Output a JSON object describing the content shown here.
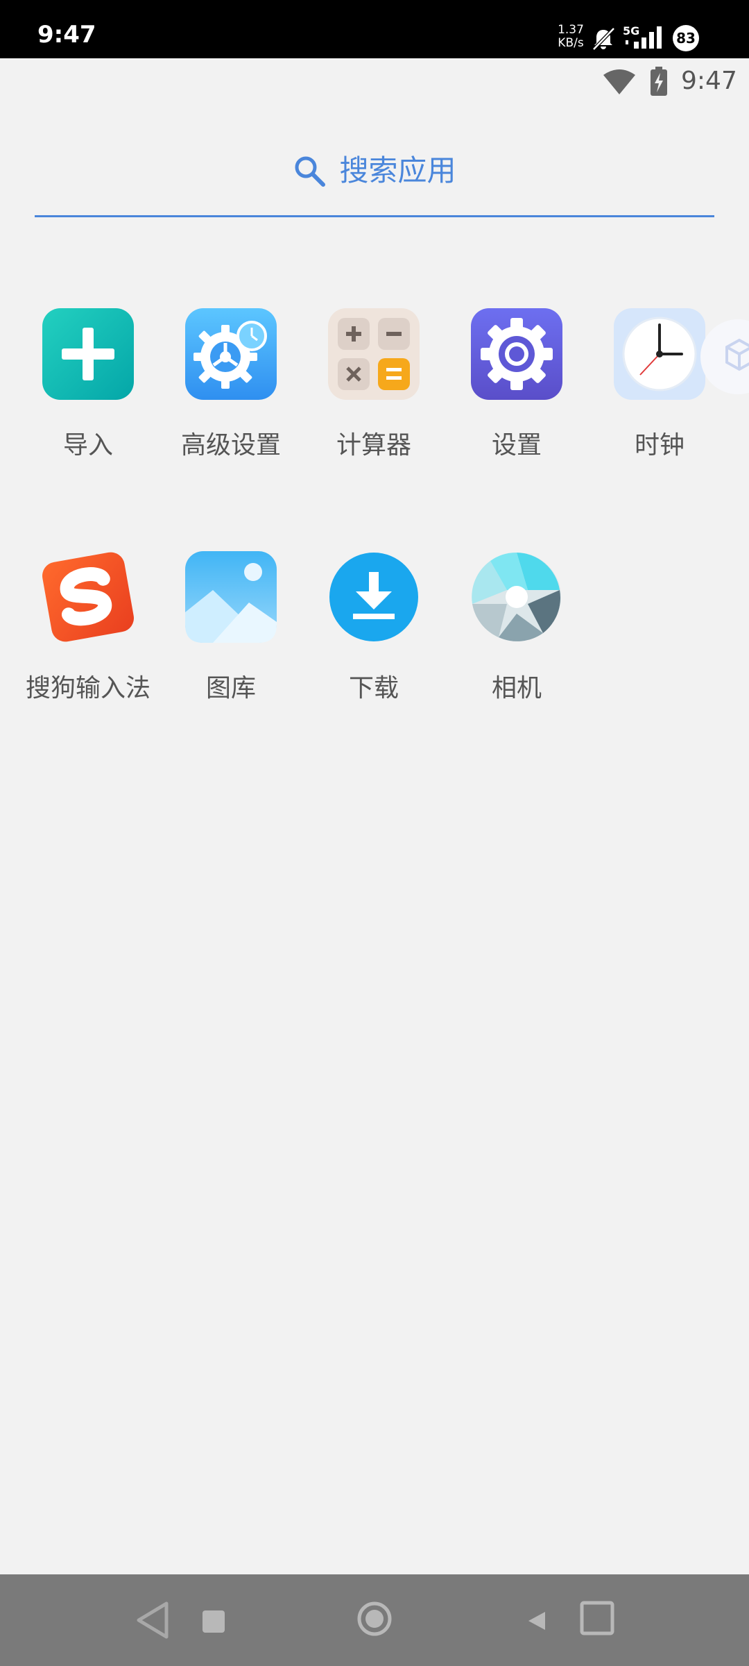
{
  "status_bar": {
    "time": "9:47",
    "net_speed_value": "1.37",
    "net_speed_unit": "KB/s",
    "network_type": "5G",
    "battery": "83"
  },
  "app_status": {
    "time": "9:47"
  },
  "search": {
    "placeholder": "搜索应用"
  },
  "apps": [
    {
      "label": "导入",
      "icon": "import-icon"
    },
    {
      "label": "高级设置",
      "icon": "advanced-settings-icon"
    },
    {
      "label": "计算器",
      "icon": "calculator-icon"
    },
    {
      "label": "设置",
      "icon": "settings-icon"
    },
    {
      "label": "时钟",
      "icon": "clock-icon"
    },
    {
      "label": "搜狗输入法",
      "icon": "sogou-input-icon"
    },
    {
      "label": "图库",
      "icon": "gallery-icon"
    },
    {
      "label": "下载",
      "icon": "download-icon"
    },
    {
      "label": "相机",
      "icon": "camera-icon"
    }
  ],
  "colors": {
    "accent": "#4a86db",
    "background": "#f2f2f2",
    "nav_bar": "#7a7a7a",
    "label": "#555555"
  }
}
